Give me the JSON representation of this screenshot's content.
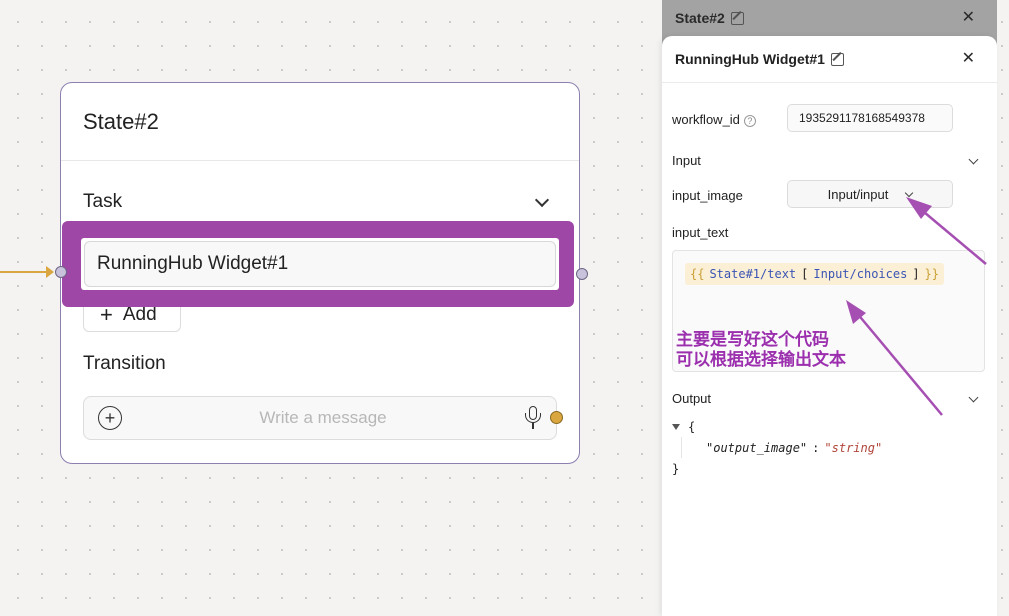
{
  "node": {
    "title": "State#2",
    "task_label": "Task",
    "widget_item": "RunningHub Widget#1",
    "add_label": "Add",
    "transition_label": "Transition",
    "message_placeholder": "Write a message"
  },
  "state_panel": {
    "title": "State#2"
  },
  "widget_panel": {
    "title": "RunningHub Widget#1",
    "workflow_id_label": "workflow_id",
    "workflow_id_value": "1935291178168549378",
    "input_section": "Input",
    "input_image_label": "input_image",
    "input_image_value": "Input/input",
    "input_text_label": "input_text",
    "code": {
      "open": "{{",
      "ref1": "State#1/text",
      "lbracket": "[",
      "ref2": "Input/choices",
      "rbracket": "]",
      "close": "}}"
    },
    "output_section": "Output",
    "output_json": {
      "open": "{",
      "key": "\"output_image\"",
      "sep": ":",
      "value": "\"string\"",
      "close": "}"
    }
  },
  "annotation": {
    "line1": "主要是写好这个代码",
    "line2": "可以根据选择输出文本",
    "color": "#9b2fae"
  },
  "colors": {
    "highlight": "#9f47a6",
    "edge": "#d9a640",
    "node_border": "#8d7fb0"
  }
}
